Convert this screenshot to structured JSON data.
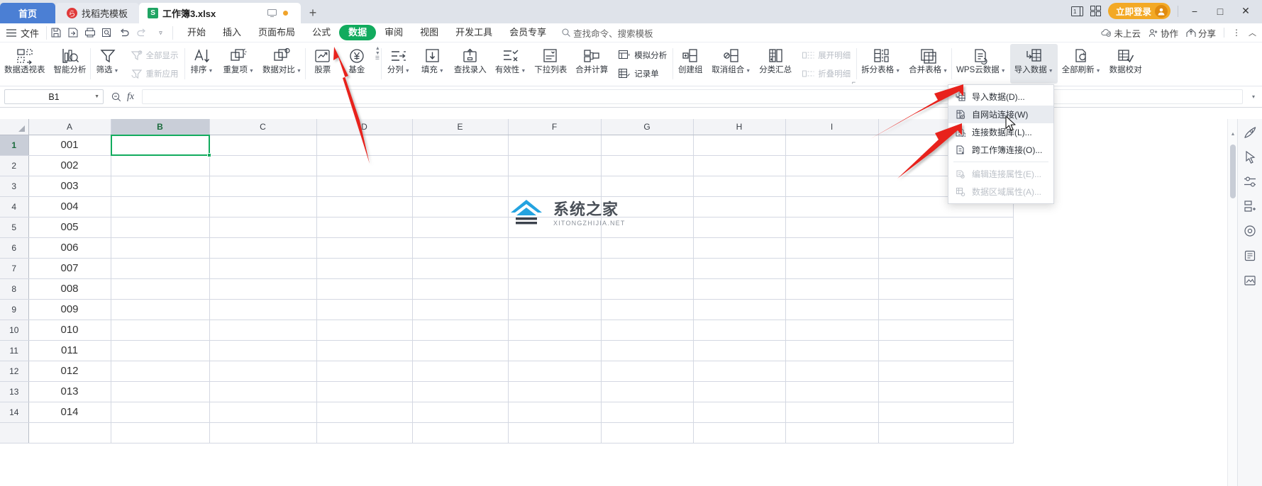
{
  "titlebar": {
    "tabs": [
      {
        "label": "首页",
        "icon": "home-tab"
      },
      {
        "label": "找稻壳模板",
        "icon": "docer-icon"
      },
      {
        "label": "工作簿3.xlsx",
        "icon": "xlsx-icon"
      }
    ],
    "new_tab_label": "+",
    "login_label": "立即登录",
    "window_controls": [
      "−",
      "□",
      "✕"
    ]
  },
  "menubar": {
    "file_label": "文件",
    "quick_access": [
      "save-icon",
      "save-as-icon",
      "print-icon",
      "print-preview-icon",
      "undo-icon",
      "redo-icon",
      "customize-caret-icon"
    ],
    "tabs": [
      {
        "label": "开始"
      },
      {
        "label": "插入"
      },
      {
        "label": "页面布局"
      },
      {
        "label": "公式"
      },
      {
        "label": "数据",
        "selected": true
      },
      {
        "label": "审阅"
      },
      {
        "label": "视图"
      },
      {
        "label": "开发工具"
      },
      {
        "label": "会员专享"
      }
    ],
    "search_placeholder": "查找命令、搜索模板",
    "right_items": [
      {
        "label": "未上云",
        "icon": "cloud-off-icon"
      },
      {
        "label": "协作",
        "icon": "collaborate-icon"
      },
      {
        "label": "分享",
        "icon": "share-icon"
      }
    ]
  },
  "ribbon": {
    "groups": [
      {
        "buttons": [
          {
            "label": "数据透视表",
            "icon": "pivot-table-icon",
            "caret": false
          },
          {
            "label": "智能分析",
            "icon": "smart-analysis-icon",
            "caret": false
          }
        ]
      },
      {
        "buttons": [
          {
            "label": "筛选",
            "icon": "filter-icon",
            "caret": true
          }
        ],
        "stack": [
          {
            "label": "全部显示",
            "icon": "show-all-icon",
            "disabled": true
          },
          {
            "label": "重新应用",
            "icon": "reapply-icon",
            "disabled": true
          }
        ]
      },
      {
        "buttons": [
          {
            "label": "排序",
            "icon": "sort-icon",
            "caret": true
          },
          {
            "label": "重复项",
            "icon": "duplicates-icon",
            "caret": true
          },
          {
            "label": "数据对比",
            "icon": "data-compare-icon",
            "caret": true
          }
        ]
      },
      {
        "buttons": [
          {
            "label": "股票",
            "icon": "stock-icon",
            "caret": false
          },
          {
            "label": "基金",
            "icon": "fund-icon",
            "caret": false
          }
        ]
      },
      {
        "buttons": [
          {
            "label": "分列",
            "icon": "text-to-columns-icon",
            "caret": true
          },
          {
            "label": "填充",
            "icon": "fill-icon",
            "caret": true
          },
          {
            "label": "查找录入",
            "icon": "lookup-entry-icon",
            "caret": false
          },
          {
            "label": "有效性",
            "icon": "validation-icon",
            "caret": true
          },
          {
            "label": "下拉列表",
            "icon": "dropdown-list-icon",
            "caret": false
          },
          {
            "label": "合并计算",
            "icon": "consolidate-icon",
            "caret": false
          }
        ],
        "stack": [
          {
            "label": "模拟分析",
            "icon": "what-if-icon",
            "disabled": false
          },
          {
            "label": "记录单",
            "icon": "record-form-icon",
            "disabled": false
          }
        ]
      },
      {
        "buttons": [
          {
            "label": "创建组",
            "icon": "group-icon",
            "caret": false
          },
          {
            "label": "取消组合",
            "icon": "ungroup-icon",
            "caret": true
          },
          {
            "label": "分类汇总",
            "icon": "subtotal-icon",
            "caret": false
          }
        ],
        "stack": [
          {
            "label": "展开明细",
            "icon": "expand-detail-icon",
            "disabled": true
          },
          {
            "label": "折叠明细",
            "icon": "collapse-detail-icon",
            "disabled": true
          }
        ]
      },
      {
        "buttons": [
          {
            "label": "拆分表格",
            "icon": "split-table-icon",
            "caret": true
          },
          {
            "label": "合并表格",
            "icon": "merge-table-icon",
            "caret": true
          }
        ]
      },
      {
        "buttons": [
          {
            "label": "WPS云数据",
            "icon": "wps-cloud-data-icon",
            "caret": true
          },
          {
            "label": "导入数据",
            "icon": "import-data-icon",
            "caret": true,
            "highlighted": true
          },
          {
            "label": "全部刷新",
            "icon": "refresh-all-icon",
            "caret": true
          },
          {
            "label": "数据校对",
            "icon": "data-proofread-icon",
            "caret": false
          }
        ]
      }
    ]
  },
  "dropdown": {
    "items": [
      {
        "label": "导入数据(D)...",
        "icon": "import-data-icon",
        "disabled": false,
        "hover": false
      },
      {
        "label": "自网站连接(W)",
        "icon": "web-connect-icon",
        "disabled": false,
        "hover": true
      },
      {
        "label": "连接数据库(L)...",
        "icon": "connect-database-icon",
        "disabled": false,
        "hover": false
      },
      {
        "label": "跨工作簿连接(O)...",
        "icon": "cross-workbook-icon",
        "disabled": false,
        "hover": false
      },
      {
        "separator": true
      },
      {
        "label": "编辑连接属性(E)...",
        "icon": "edit-connection-icon",
        "disabled": true,
        "hover": false
      },
      {
        "label": "数据区域属性(A)...",
        "icon": "data-range-props-icon",
        "disabled": true,
        "hover": false
      }
    ]
  },
  "formulabar": {
    "name_box_value": "B1",
    "formula_value": "",
    "fx_label": "fx"
  },
  "grid": {
    "columns": [
      "A",
      "B",
      "C",
      "D",
      "E",
      "F",
      "G",
      "H",
      "I"
    ],
    "selected_column": "B",
    "selected_row": 1,
    "selected_cell": "B1",
    "rows": [
      {
        "num": "1",
        "a": "001"
      },
      {
        "num": "2",
        "a": "002"
      },
      {
        "num": "3",
        "a": "003"
      },
      {
        "num": "4",
        "a": "004"
      },
      {
        "num": "5",
        "a": "005"
      },
      {
        "num": "6",
        "a": "006"
      },
      {
        "num": "7",
        "a": "007"
      },
      {
        "num": "8",
        "a": "008"
      },
      {
        "num": "9",
        "a": "009"
      },
      {
        "num": "10",
        "a": "010"
      },
      {
        "num": "11",
        "a": "011"
      },
      {
        "num": "12",
        "a": "012"
      },
      {
        "num": "13",
        "a": "013"
      },
      {
        "num": "14",
        "a": "014"
      }
    ]
  },
  "watermark": {
    "main": "系统之家",
    "sub": "XITONGZHIJIA.NET"
  },
  "sidebar": {
    "icons": [
      "rocket-icon",
      "cursor-icon",
      "slider-icon",
      "table-tool-icon",
      "shape-icon",
      "clipboard-icon",
      "image-tool-icon"
    ]
  },
  "colors": {
    "accent_green": "#12ab5e",
    "title_bar": "#dfe3ea",
    "home_tab_blue": "#4b7fd4",
    "login_orange": "#f3a925",
    "arrow_red": "#e8201b",
    "header_gray": "#f3f4f7"
  }
}
